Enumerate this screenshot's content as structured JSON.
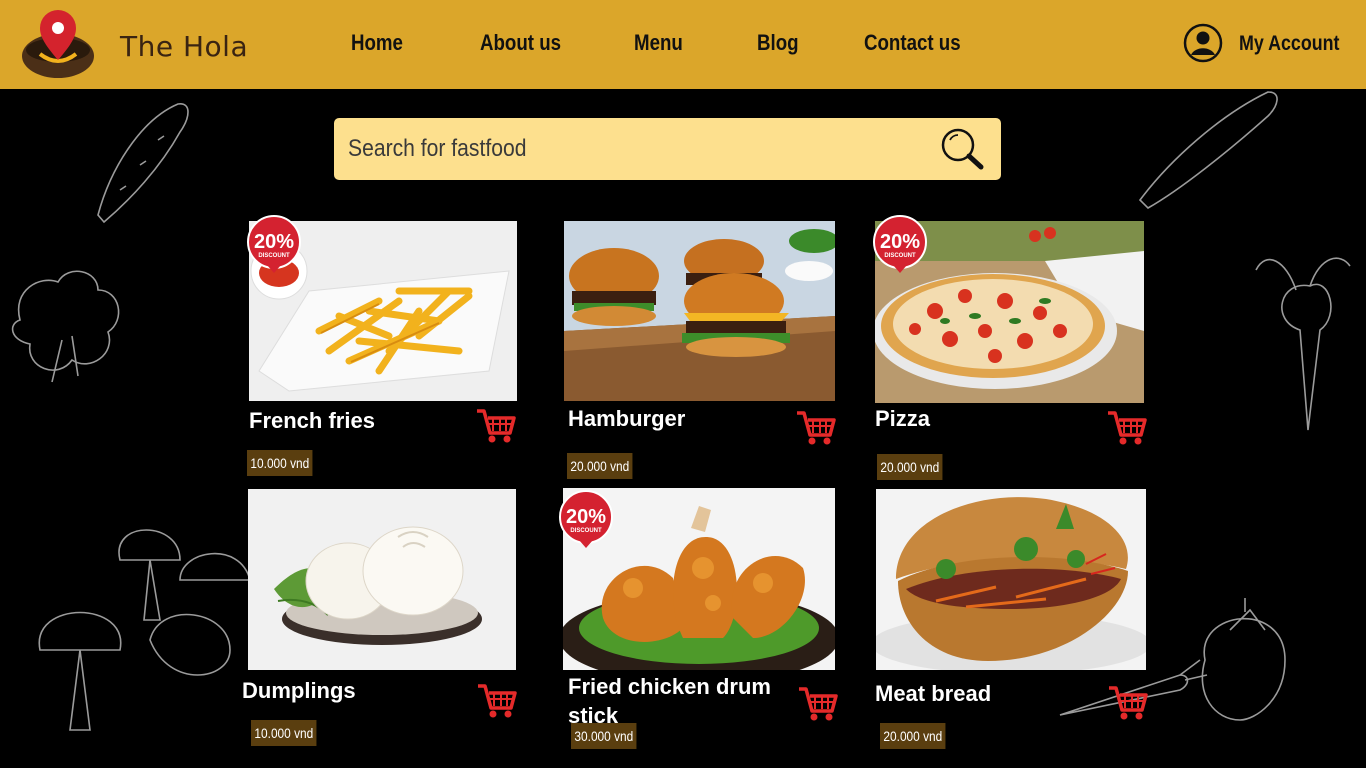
{
  "brand": {
    "name": "The Hola",
    "logo_icon": "location-pin-bowl-icon"
  },
  "nav": {
    "items": [
      "Home",
      "About us",
      "Menu",
      "Blog",
      "Contact us"
    ]
  },
  "account": {
    "label": "My Account",
    "icon": "user-circle-icon"
  },
  "search": {
    "placeholder": "Search for fastfood",
    "icon": "search-icon"
  },
  "colors": {
    "header": "#dba62a",
    "search_bg": "#fde08e",
    "price_bg": "#5a3e0f",
    "cart": "#e52a2a",
    "badge": "#d42230"
  },
  "discount_badge": {
    "value": "20%",
    "label": "DISCOUNT"
  },
  "products": [
    {
      "name": "French fries",
      "price": "10.000 vnd",
      "discount": true,
      "cart_icon": "cart-icon"
    },
    {
      "name": "Hamburger",
      "price": "20.000 vnd",
      "discount": false,
      "cart_icon": "cart-icon"
    },
    {
      "name": "Pizza",
      "price": "20.000 vnd",
      "discount": true,
      "cart_icon": "cart-icon"
    },
    {
      "name": "Dumplings",
      "price": "10.000 vnd",
      "discount": false,
      "cart_icon": "cart-icon"
    },
    {
      "name": "Fried chicken drum stick",
      "price": "30.000 vnd",
      "discount": true,
      "cart_icon": "cart-icon"
    },
    {
      "name": "Meat bread",
      "price": "20.000 vnd",
      "discount": false,
      "cart_icon": "cart-icon"
    }
  ]
}
